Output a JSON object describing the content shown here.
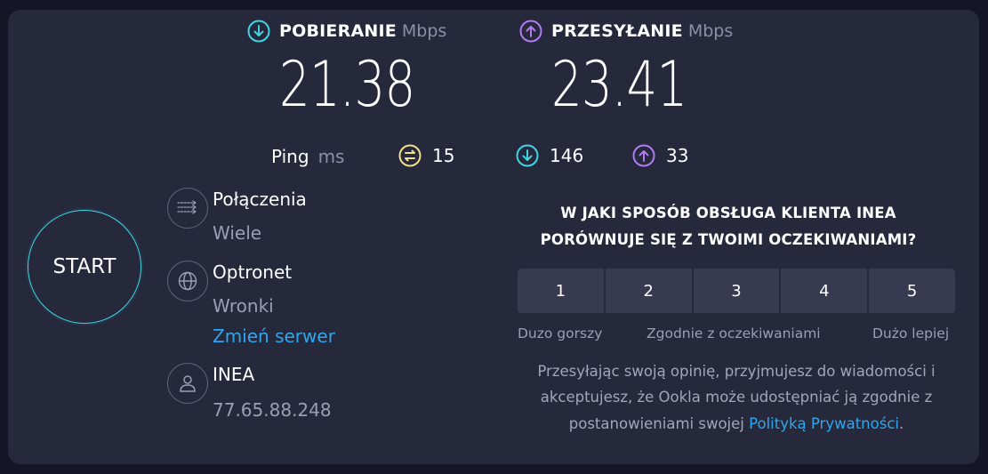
{
  "download": {
    "title": "POBIERANIE",
    "unit": "Mbps",
    "value": "21.38",
    "color": "#3ed6e3"
  },
  "upload": {
    "title": "PRZESYŁANIE",
    "unit": "Mbps",
    "value": "23.41",
    "color": "#b07cf0"
  },
  "ping": {
    "label": "Ping",
    "unit": "ms",
    "idle": {
      "value": "15",
      "color": "#f0e087"
    },
    "download": {
      "value": "146",
      "color": "#3ed6e3"
    },
    "upload": {
      "value": "33",
      "color": "#b07cf0"
    }
  },
  "start_label": "START",
  "connections": {
    "title": "Połączenia",
    "value": "Wiele",
    "icon": "connections-icon"
  },
  "server": {
    "name": "Optronet",
    "location": "Wronki",
    "change_link": "Zmień serwer",
    "icon": "globe-icon"
  },
  "provider": {
    "name": "INEA",
    "ip": "77.65.88.248",
    "icon": "user-icon"
  },
  "survey": {
    "question_line1": "W JAKI SPOSÓB OBSŁUGA KLIENTA INEA",
    "question_line2": "PORÓWNUJE SIĘ Z TWOIMI OCZEKIWANIAMI?",
    "options": [
      "1",
      "2",
      "3",
      "4",
      "5"
    ],
    "label_low": "Duzo gorszy",
    "label_mid": "Zgodnie z oczekiwaniami",
    "label_high": "Dużo lepiej",
    "consent_line1": "Przesyłając swoją opinię, przyjmujesz do wiadomości i",
    "consent_line2": "akceptujesz, że Ookla może udostępniać ją zgodnie z",
    "consent_line3_prefix": "postanowieniami swojej",
    "policy_link": "Polityką Prywatności",
    "consent_line3_suffix": "."
  }
}
